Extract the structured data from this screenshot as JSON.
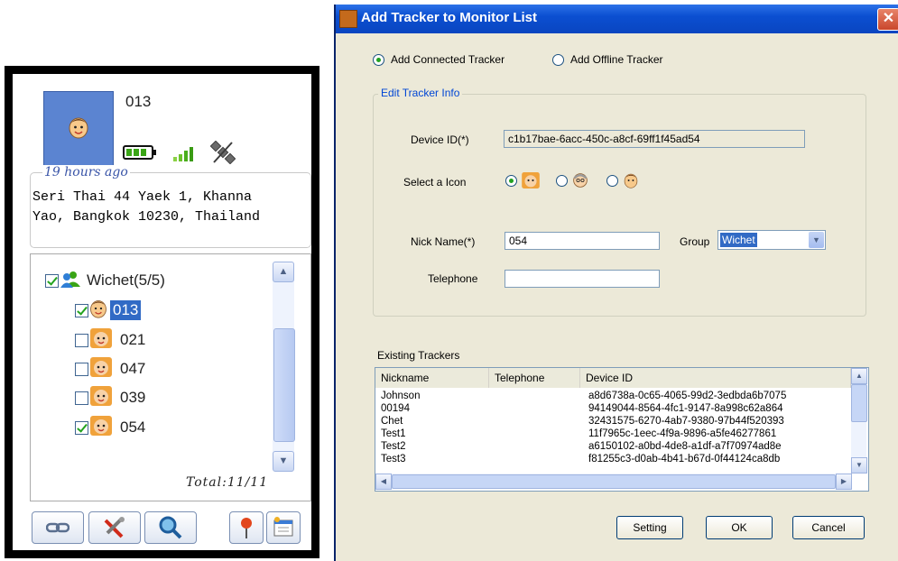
{
  "panel": {
    "device_name": "013",
    "time_ago": "19 hours ago",
    "address_line1": "Seri Thai 44 Yaek 1, Khanna",
    "address_line2": "Yao, Bangkok 10230, Thailand",
    "total_label": "Total:11/11",
    "tree": {
      "group_label": "Wichet(5/5)",
      "group_checked": true,
      "items": [
        {
          "label": "013",
          "checked": true,
          "selected": true
        },
        {
          "label": "021",
          "checked": false
        },
        {
          "label": "047",
          "checked": false
        },
        {
          "label": "039",
          "checked": false
        },
        {
          "label": "054",
          "checked": true
        }
      ]
    },
    "toolbar_icons": [
      "link-icon",
      "tools-icon",
      "search-icon",
      "pin-icon",
      "settings-icon"
    ]
  },
  "dialog": {
    "title": "Add Tracker to Monitor List",
    "close_glyph": "✕",
    "mode_connected": "Add Connected Tracker",
    "mode_offline": "Add Offline Tracker",
    "group_caption": "Edit Tracker Info",
    "device_id_label": "Device ID(*)",
    "device_id_value": "c1b17bae-6acc-450c-a8cf-69ff1f45ad54",
    "icon_label": "Select a Icon",
    "nick_label": "Nick Name(*)",
    "nick_value": "054",
    "group_label": "Group",
    "group_value": "Wichet",
    "telephone_label": "Telephone",
    "telephone_value": "",
    "existing_label": "Existing Trackers",
    "columns": [
      "Nickname",
      "Telephone",
      "Device ID"
    ],
    "rows": [
      {
        "nickname": "Johnson",
        "telephone": "",
        "device_id": "a8d6738a-0c65-4065-99d2-3edbda6b7075"
      },
      {
        "nickname": "00194",
        "telephone": "",
        "device_id": "94149044-8564-4fc1-9147-8a998c62a864"
      },
      {
        "nickname": "Chet",
        "telephone": "",
        "device_id": "32431575-6270-4ab7-9380-97b44f520393"
      },
      {
        "nickname": "Test1",
        "telephone": "",
        "device_id": "11f7965c-1eec-4f9a-9896-a5fe46277861"
      },
      {
        "nickname": "Test2",
        "telephone": "",
        "device_id": "a6150102-a0bd-4de8-a1df-a7f70974ad8e"
      },
      {
        "nickname": "Test3",
        "telephone": "",
        "device_id": "f81255c3-d0ab-4b41-b67d-0f44124ca8db"
      }
    ],
    "btn_setting": "Setting",
    "btn_ok": "OK",
    "btn_cancel": "Cancel"
  },
  "colors": {
    "title_bar": "#0b4fd1",
    "selection": "#316ac5",
    "avatar_bg": "#5b84d1",
    "time_ago_text": "#3a55a8"
  }
}
